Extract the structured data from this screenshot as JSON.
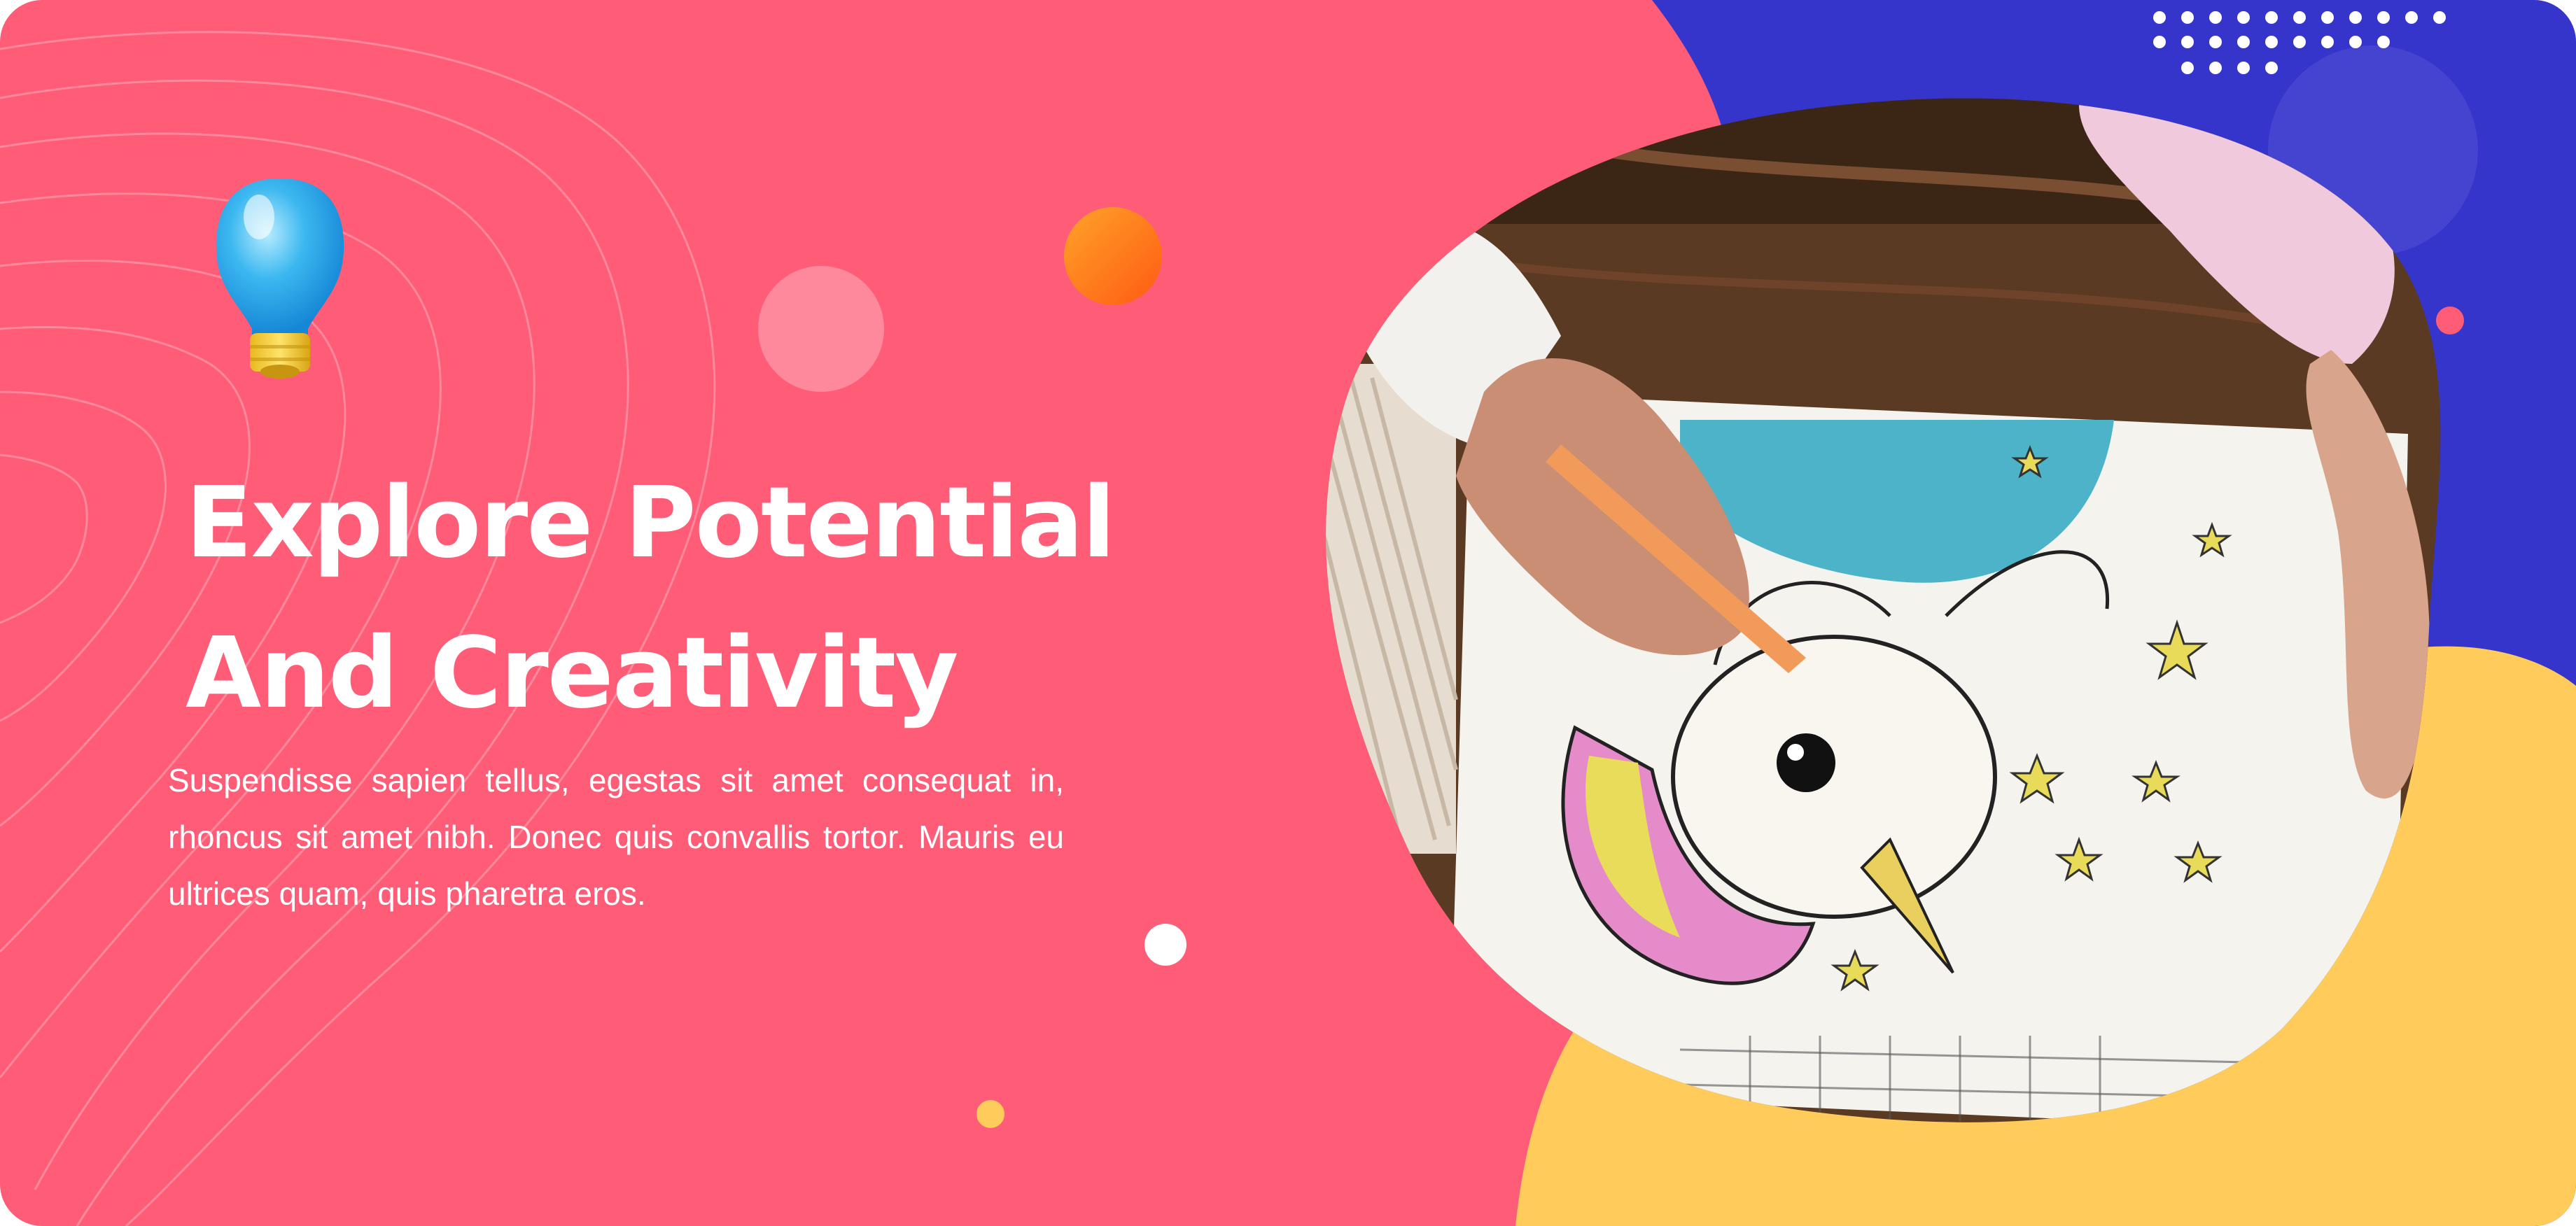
{
  "hero": {
    "headline_line1": "Explore Potential",
    "headline_line2": "And Creativity",
    "body": "Suspendisse sapien tellus, egestas sit amet consequat in, rhoncus sit amet nibh. Donec quis convallis tortor. Mauris eu ultrices quam, quis pharetra eros."
  },
  "colors": {
    "background": "#FF5C77",
    "blue_panel": "#3535CC",
    "yellow_blob": "#FFCC5C",
    "orange_circle": "#FF7A1A",
    "text": "#FFFFFF"
  },
  "icons": {
    "lightbulb": "lightbulb-icon"
  },
  "image": {
    "subject": "child-coloring-unicorn-photo"
  }
}
